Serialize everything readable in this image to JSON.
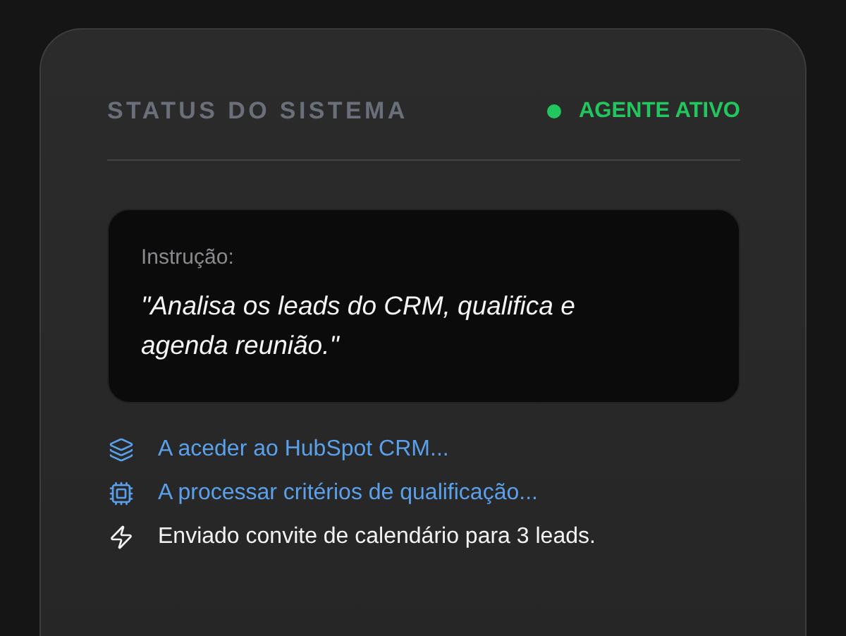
{
  "header": {
    "title": "STATUS DO SISTEMA",
    "status": {
      "label": "AGENTE ATIVO",
      "color": "#22c55e"
    }
  },
  "instruction": {
    "label": "Instrução:",
    "text": "\"Analisa os leads do CRM, qualifica e agenda reunião.\""
  },
  "steps": [
    {
      "kind": "layers",
      "text": "A aceder ao HubSpot CRM...",
      "done": false
    },
    {
      "kind": "cpu",
      "text": "A processar critérios de qualificação...",
      "done": false
    },
    {
      "kind": "zap",
      "text": "Enviado convite de calendário para 3 leads.",
      "done": true
    }
  ]
}
